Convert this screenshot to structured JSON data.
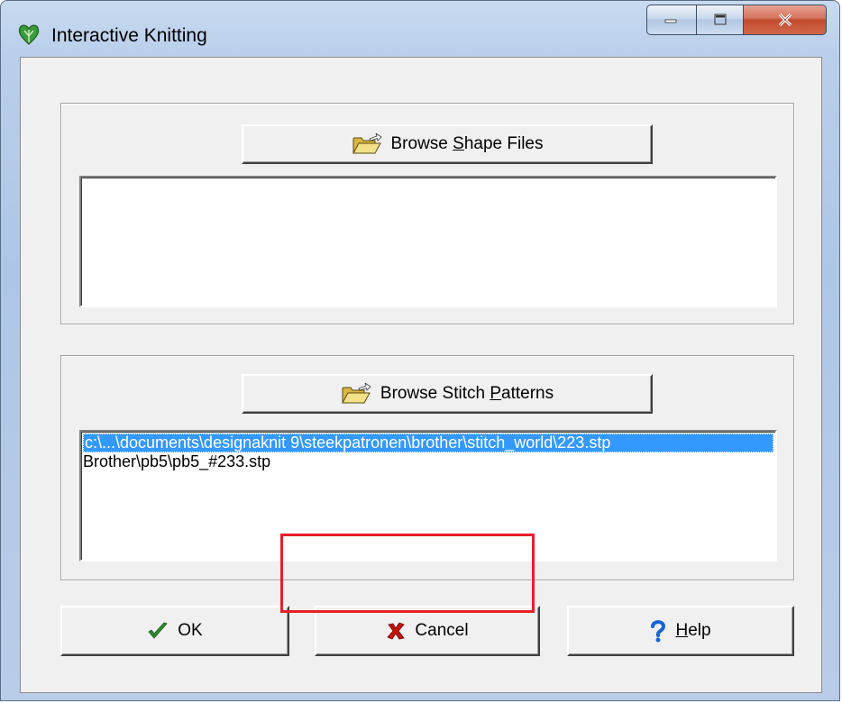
{
  "window": {
    "title": "Interactive Knitting",
    "app_icon": "knitting-heart-icon",
    "controls": [
      "minimize-icon",
      "maximize-icon",
      "close-icon"
    ]
  },
  "shape_group": {
    "browse_button": {
      "prefix": "Browse ",
      "accel": "S",
      "suffix": "hape Files",
      "icon": "open-folder-icon"
    },
    "files": []
  },
  "stitch_group": {
    "browse_button": {
      "prefix": "Browse Stitch ",
      "accel": "P",
      "suffix": "atterns",
      "icon": "open-folder-icon"
    },
    "files": [
      "c:\\...\\documents\\designaknit 9\\steekpatronen\\brother\\stitch_world\\223.stp",
      "Brother\\pb5\\pb5_#233.stp"
    ],
    "selected_index": 0
  },
  "buttons": {
    "ok": {
      "label": "OK",
      "icon": "checkmark-icon"
    },
    "cancel": {
      "label": "Cancel",
      "icon": "red-x-icon"
    },
    "help": {
      "prefix": "",
      "accel": "H",
      "suffix": "elp",
      "icon": "question-mark-icon"
    }
  },
  "colors": {
    "selection": "#3399ff",
    "highlight_frame": "#e8202a",
    "ok_check": "#2e8b2e",
    "cancel_x": "#c81010",
    "help_q": "#1565d8"
  }
}
